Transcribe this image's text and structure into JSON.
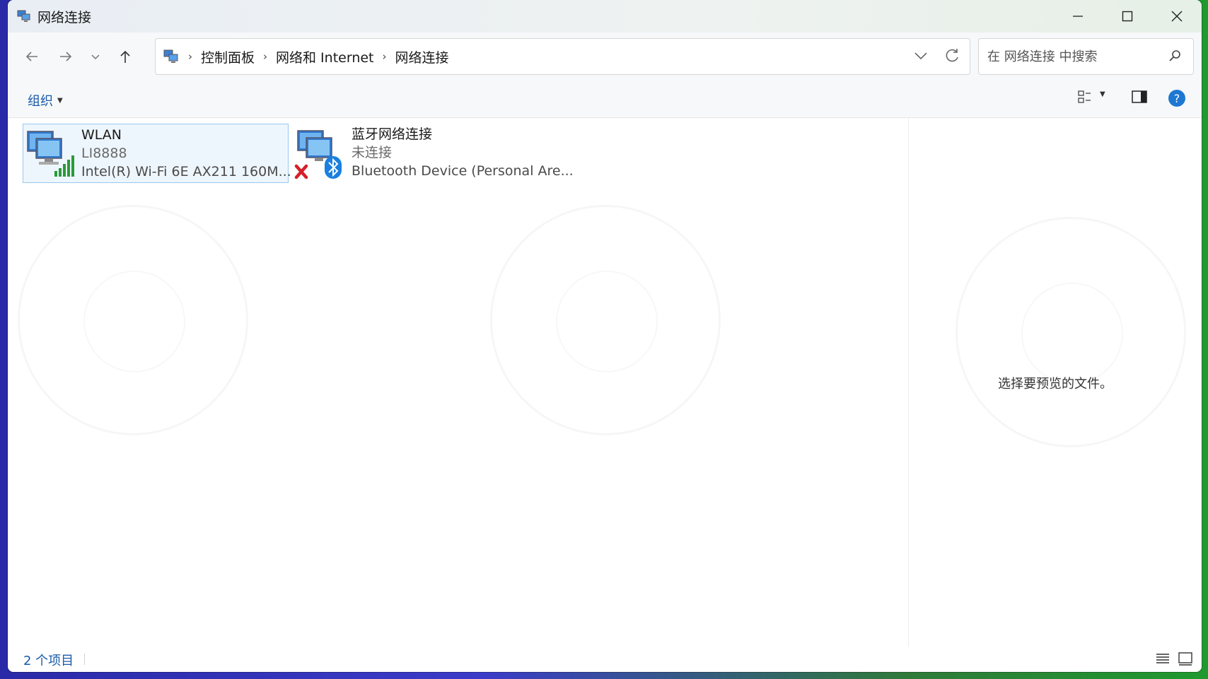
{
  "window": {
    "title": "网络连接"
  },
  "address": {
    "crumbs": [
      "控制面板",
      "网络和 Internet",
      "网络连接"
    ]
  },
  "search": {
    "placeholder": "在 网络连接 中搜索"
  },
  "command_bar": {
    "organize_label": "组织"
  },
  "items": [
    {
      "name": "WLAN",
      "status": "LI8888",
      "device": "Intel(R) Wi-Fi 6E AX211 160M...",
      "selected": true
    },
    {
      "name": "蓝牙网络连接",
      "status": "未连接",
      "device": "Bluetooth Device (Personal Are...",
      "selected": false
    }
  ],
  "preview": {
    "message": "选择要预览的文件。"
  },
  "status_bar": {
    "item_count": "2 个项目"
  },
  "colors": {
    "accent": "#1a5aa8",
    "selection_border": "#99c8f0",
    "help": "#1e78d2"
  }
}
